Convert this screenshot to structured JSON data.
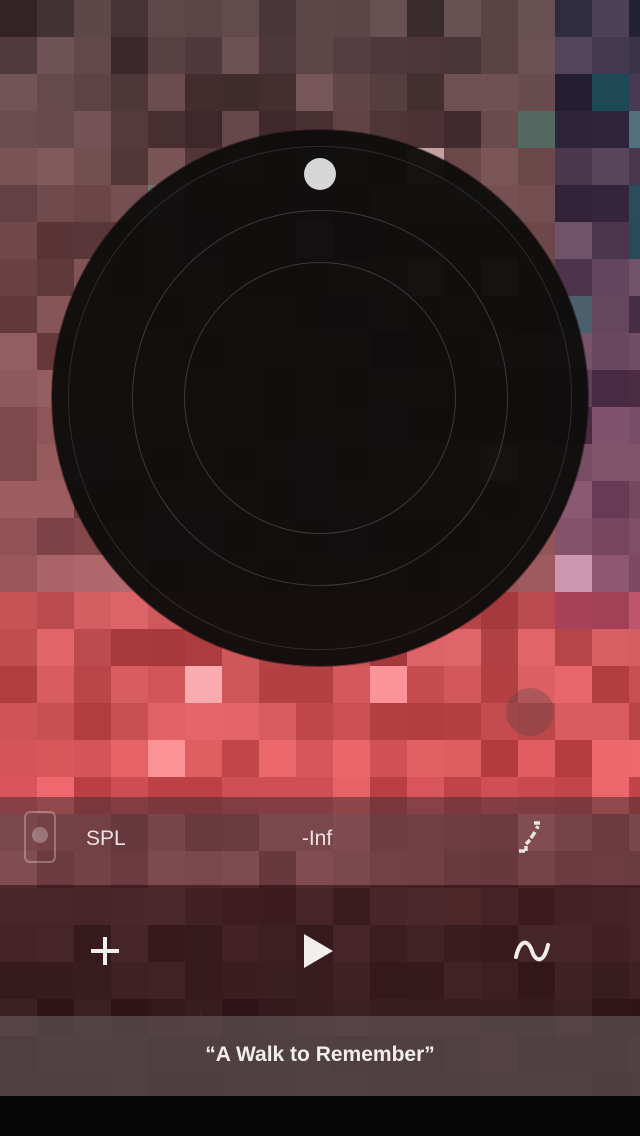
{
  "info_bar": {
    "meter_label": "SPL",
    "meter_value": "-Inf",
    "curve_icon": "step-curve-icon",
    "phone_icon": "phone-mic-icon"
  },
  "controls": {
    "add_icon": "plus-icon",
    "play_icon": "play-icon",
    "wave_icon": "sine-wave-icon"
  },
  "track": {
    "title": "“A Walk to Remember”"
  },
  "colors": {
    "dial": "#0e0c0c",
    "knob": "#d6d6d6",
    "text": "#e8e4e4"
  }
}
